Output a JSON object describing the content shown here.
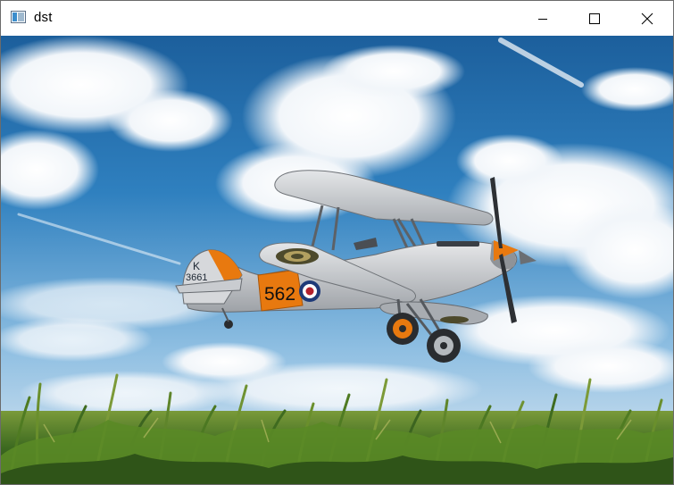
{
  "window": {
    "title": "dst",
    "icons": {
      "app": "app-window-icon",
      "minimize": "minimize-icon",
      "maximize": "maximize-icon",
      "close": "close-icon"
    }
  },
  "image": {
    "subject": "biplane",
    "aircraft_markings": {
      "fuselage_number": "562",
      "tail_letter": "K",
      "tail_number": "3661"
    },
    "colors": {
      "sky_top": "#1f6aa8",
      "sky_bottom": "#cfe3f3",
      "aircraft_body": "#c9ccd0",
      "aircraft_orange": "#e8790f",
      "grass": "#3f6b1f"
    }
  }
}
